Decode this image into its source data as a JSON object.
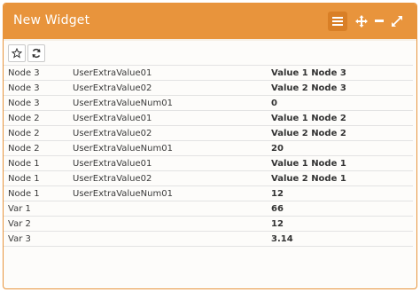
{
  "widget": {
    "title": "New Widget",
    "header_color": "#e8943c",
    "icons": [
      "menu-icon",
      "move-icon",
      "minimize-icon",
      "maximize-icon"
    ]
  },
  "toolbar": {
    "buttons": [
      "star-icon",
      "refresh-icon"
    ]
  },
  "rows": [
    {
      "node": "Node 3",
      "key": "UserExtraValue01",
      "value": "Value 1 Node 3"
    },
    {
      "node": "Node 3",
      "key": "UserExtraValue02",
      "value": "Value 2 Node 3"
    },
    {
      "node": "Node 3",
      "key": "UserExtraValueNum01",
      "value": "0"
    },
    {
      "node": "Node 2",
      "key": "UserExtraValue01",
      "value": "Value 1 Node 2"
    },
    {
      "node": "Node 2",
      "key": "UserExtraValue02",
      "value": "Value 2 Node 2"
    },
    {
      "node": "Node 2",
      "key": "UserExtraValueNum01",
      "value": "20"
    },
    {
      "node": "Node 1",
      "key": "UserExtraValue01",
      "value": "Value 1 Node 1"
    },
    {
      "node": "Node 1",
      "key": "UserExtraValue02",
      "value": "Value 2 Node 1"
    },
    {
      "node": "Node 1",
      "key": "UserExtraValueNum01",
      "value": "12"
    },
    {
      "node": "Var 1",
      "key": "",
      "value": "66"
    },
    {
      "node": "Var 2",
      "key": "",
      "value": "12"
    },
    {
      "node": "Var 3",
      "key": "",
      "value": "3.14"
    }
  ]
}
